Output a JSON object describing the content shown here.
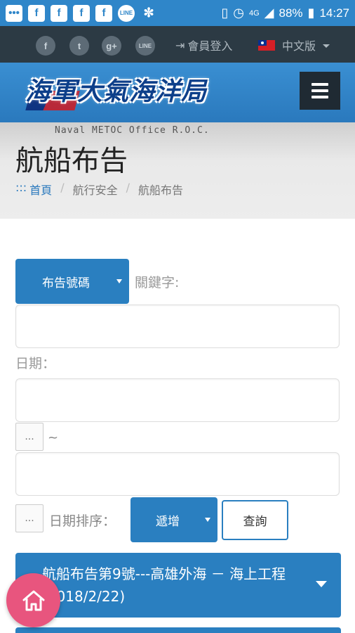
{
  "statusbar": {
    "battery": "88%",
    "time": "14:27",
    "signal_label": "4G"
  },
  "topbar": {
    "social": [
      "f",
      "t",
      "g+",
      "LINE"
    ],
    "login_label": "會員登入",
    "language_label": "中文版"
  },
  "banner": {
    "logo_text": "海軍大氣海洋局",
    "logo_subtitle": "Naval METOC Office R.O.C."
  },
  "page": {
    "title": "航船布告",
    "breadcrumb": [
      ":::",
      "首頁",
      "航行安全",
      "航船布告"
    ]
  },
  "form": {
    "field_select": "布告號碼",
    "keyword_label": "關鍵字:",
    "date_label": "日期：",
    "dots_label": "...",
    "tilde": "~",
    "sort_label": "日期排序：",
    "sort_select": "遞增",
    "query_button": "查詢"
  },
  "results": [
    {
      "title": "航船布告第9號---高雄外海 － 海上工程(2018/2/22)"
    }
  ],
  "colors": {
    "primary": "#2a7fc0",
    "topbar": "#2c3a44",
    "fab": "#e8557e"
  }
}
